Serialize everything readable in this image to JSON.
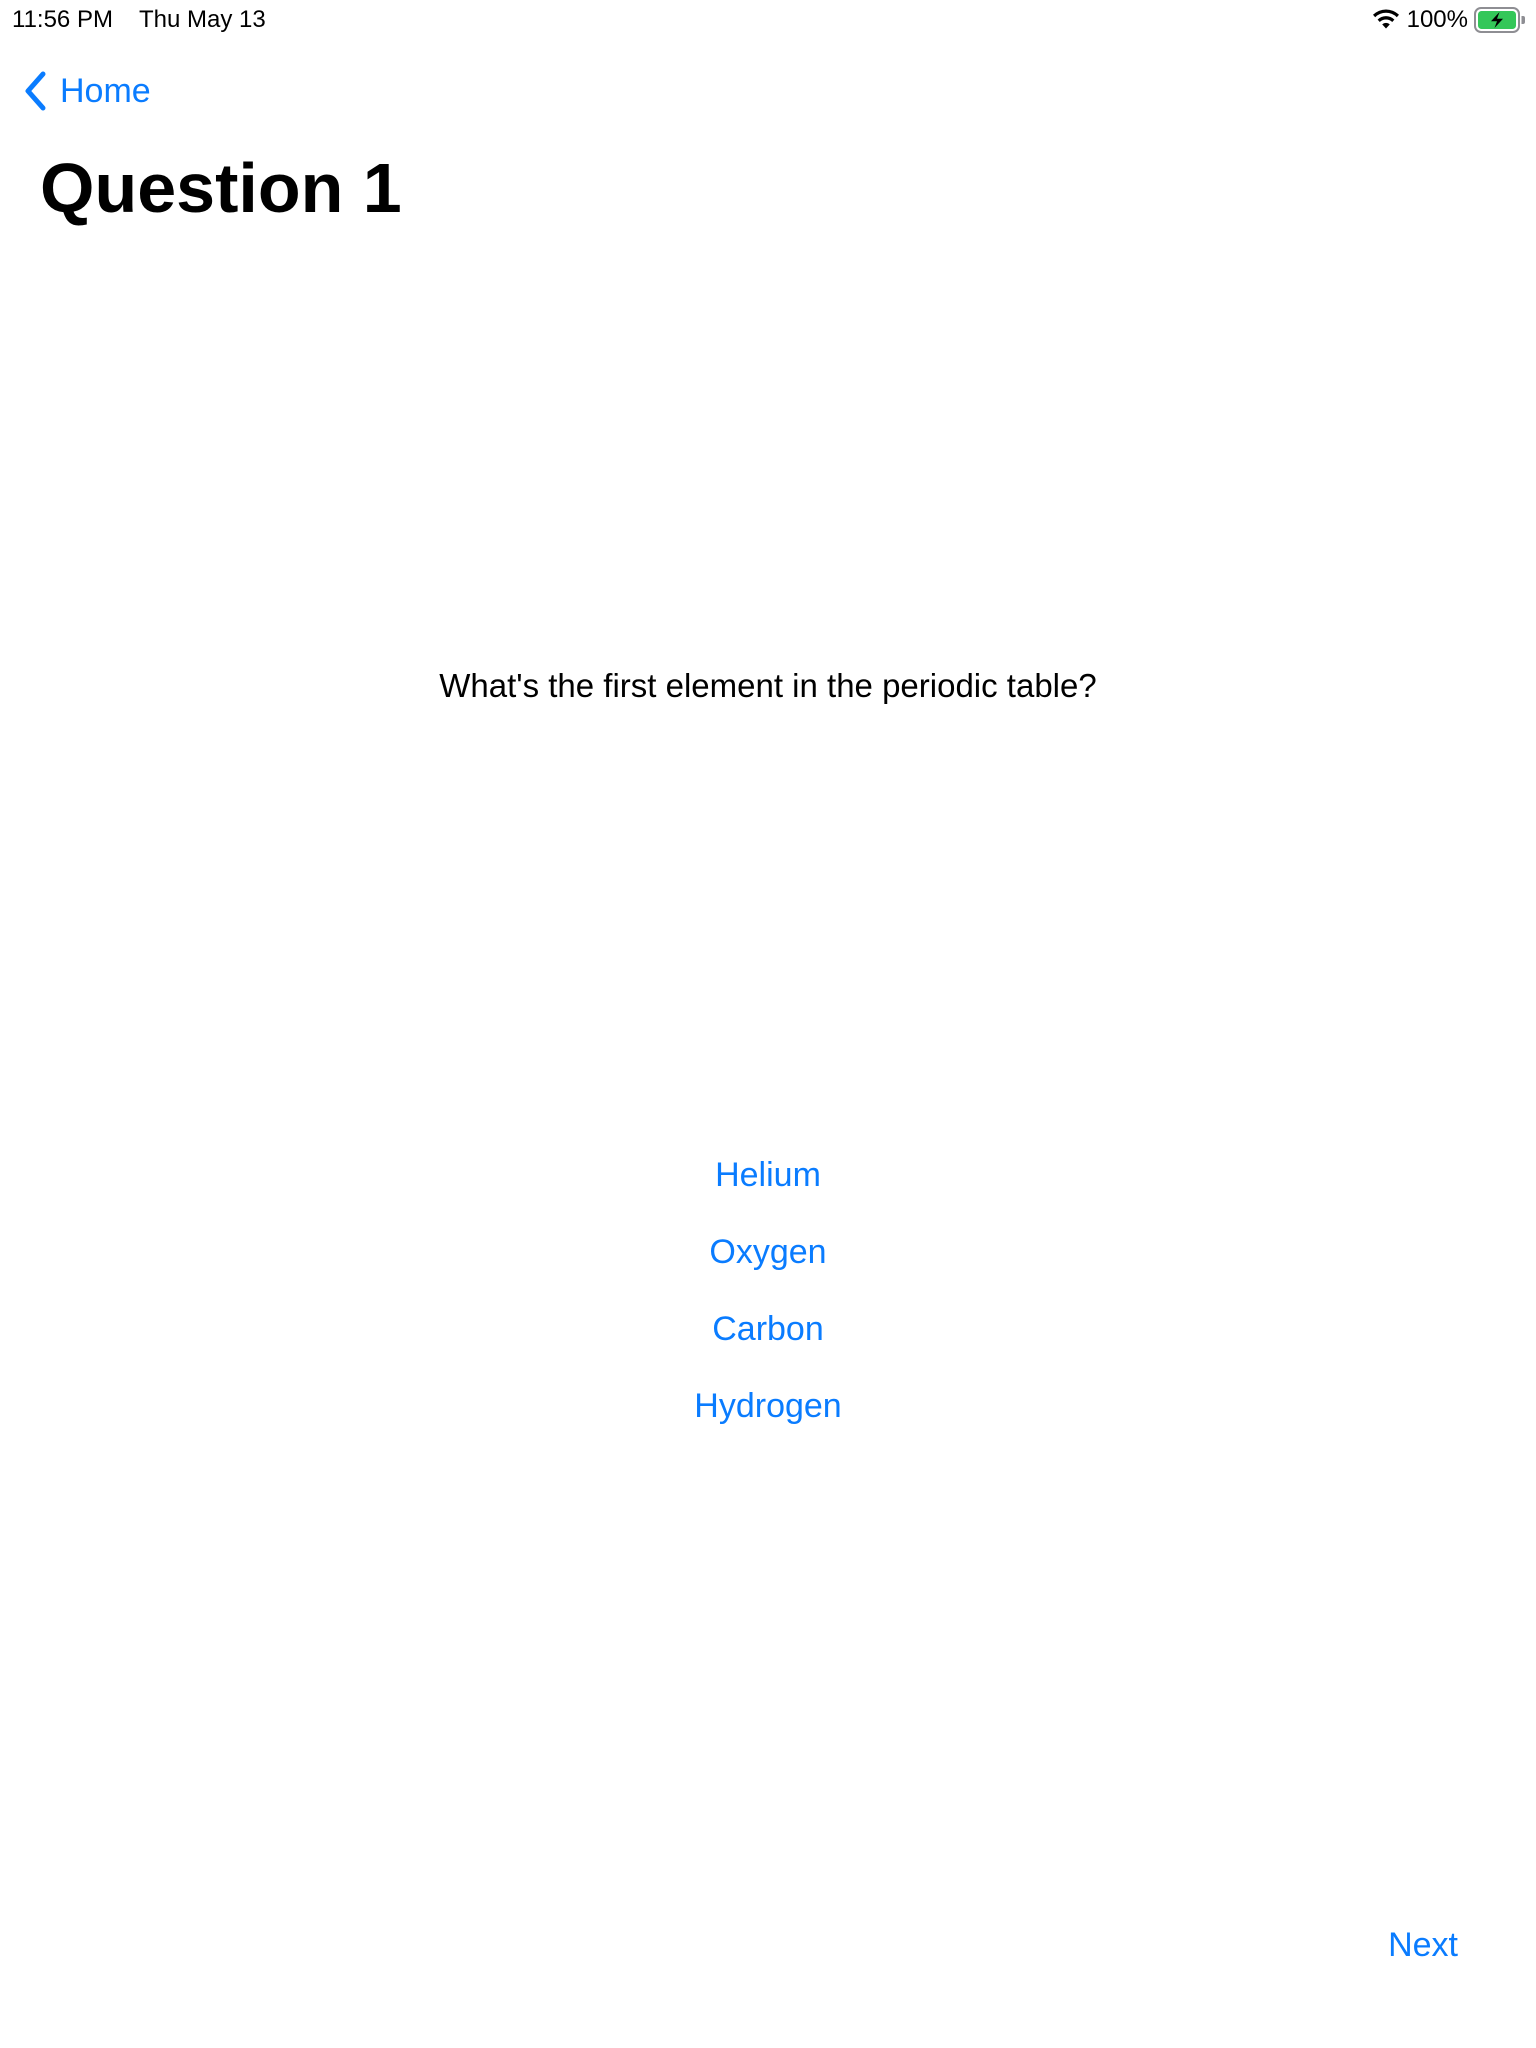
{
  "status_bar": {
    "time": "11:56 PM",
    "date": "Thu May 13",
    "battery_percent": "100%",
    "wifi_icon": "wifi-icon",
    "battery_icon": "battery-charging-icon",
    "battery_color": "#34c759"
  },
  "nav": {
    "back_label": "Home",
    "back_icon": "chevron-left-icon",
    "accent_color": "#0a7cff"
  },
  "page": {
    "title": "Question 1"
  },
  "question": {
    "text": "What's the first element in the periodic table?"
  },
  "answers": [
    {
      "label": "Helium"
    },
    {
      "label": "Oxygen"
    },
    {
      "label": "Carbon"
    },
    {
      "label": "Hydrogen"
    }
  ],
  "footer": {
    "next_label": "Next"
  }
}
